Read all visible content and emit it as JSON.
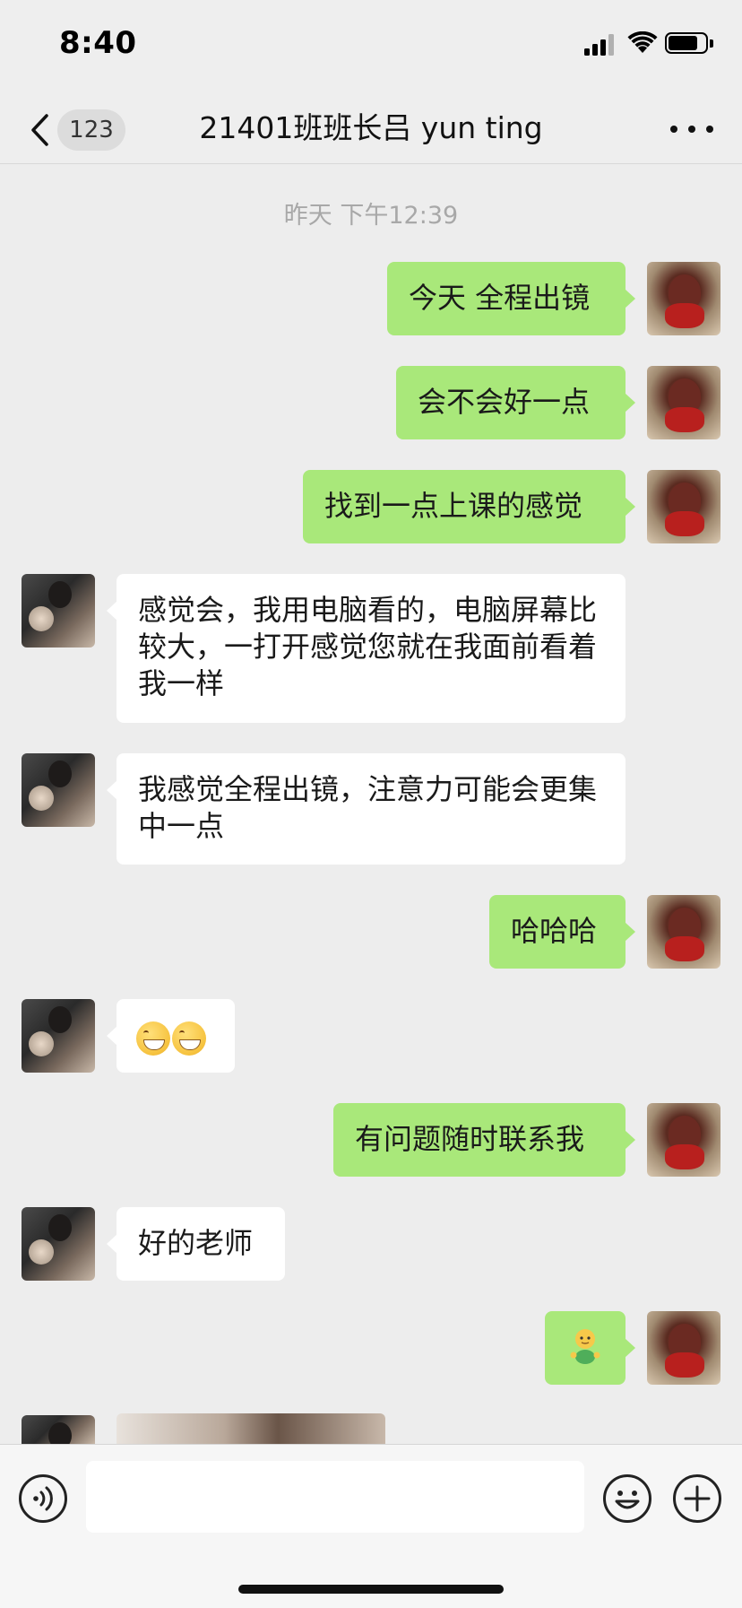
{
  "status_bar": {
    "time": "8:40"
  },
  "nav": {
    "unread_count": "123",
    "title": "21401班班长吕 yun ting"
  },
  "timestamp": "昨天 下午12:39",
  "messages": [
    {
      "sender": "self",
      "text": "今天 全程出镜"
    },
    {
      "sender": "self",
      "text": "会不会好一点"
    },
    {
      "sender": "self",
      "text": "找到一点上课的感觉"
    },
    {
      "sender": "other",
      "text": "感觉会，我用电脑看的，电脑屏幕比较大，一打开感觉您就在我面前看着我一样"
    },
    {
      "sender": "other",
      "text": "我感觉全程出镜，注意力可能会更集中一点"
    },
    {
      "sender": "self",
      "text": "哈哈哈"
    },
    {
      "sender": "other",
      "emoji": [
        "grin-emoji",
        "grin-emoji"
      ]
    },
    {
      "sender": "self",
      "text": "有问题随时联系我"
    },
    {
      "sender": "other",
      "text": "好的老师"
    },
    {
      "sender": "self",
      "emoji": [
        "figure-emoji"
      ]
    },
    {
      "sender": "other",
      "image": "photo-message"
    }
  ],
  "input": {
    "placeholder": ""
  },
  "colors": {
    "self_bubble": "#a9e87a",
    "other_bubble": "#ffffff",
    "background": "#ededed"
  },
  "icons": [
    "back-icon",
    "more-icon",
    "signal-icon",
    "wifi-icon",
    "battery-icon",
    "voice-icon",
    "emoji-icon",
    "add-icon"
  ]
}
